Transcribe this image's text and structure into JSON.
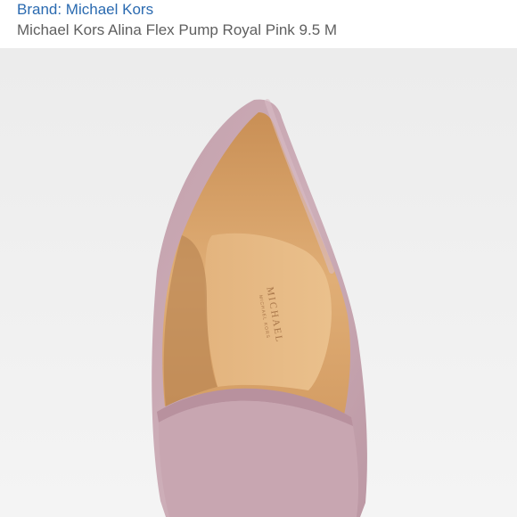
{
  "listing": {
    "brand_label": "Brand: Michael Kors",
    "title": "Michael Kors Alina Flex Pump Royal Pink 9.5 M"
  },
  "product_image": {
    "subject": "pink suede pointed-toe pump, front view",
    "insole_logo_line1": "MICHAEL",
    "insole_logo_line2": "MICHAEL KORS"
  },
  "colors": {
    "brand_link": "#2a6ab0",
    "title_text": "#5f5f5f",
    "photo_background": "#efefef",
    "suede": "#c9a9b4",
    "lining": "#d9a36a"
  }
}
